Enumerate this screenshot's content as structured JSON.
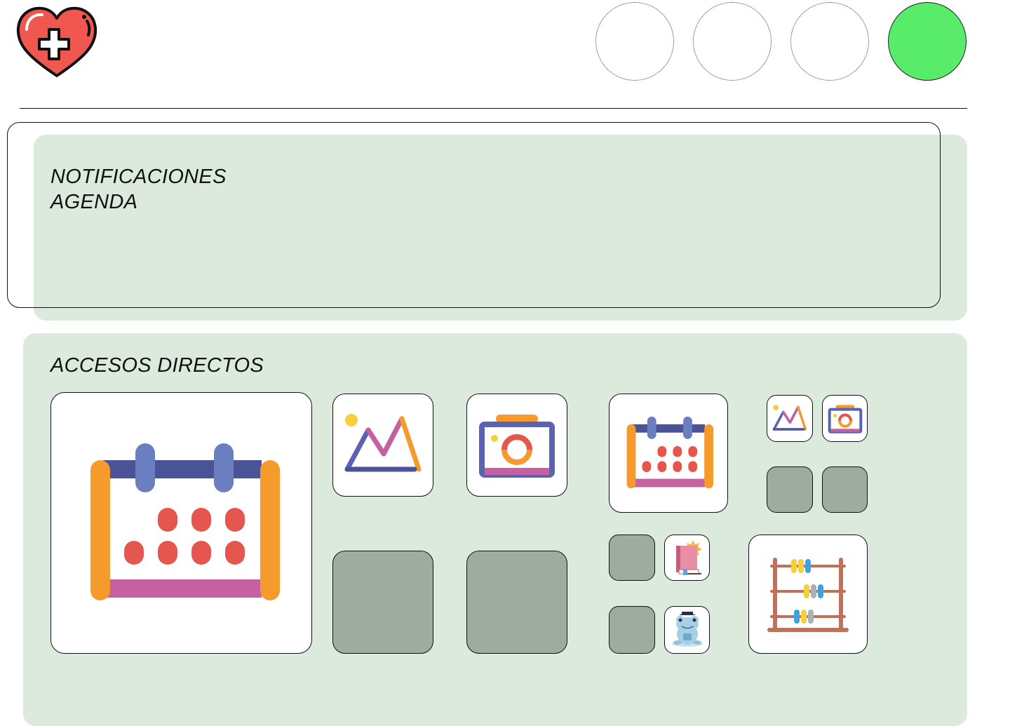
{
  "colors": {
    "panel_bg": "#dbeadd",
    "placeholder_tile": "#9eab9f",
    "active_circle": "#59ec6b",
    "icon_orange": "#f59a2c",
    "icon_navy": "#4a5398",
    "icon_blue": "#6a7ec0",
    "icon_red": "#e5564e",
    "icon_pink": "#c561a0",
    "icon_yellow": "#f5cf3c"
  },
  "header": {
    "logo_icon": "heart-plus-icon",
    "nav_circles": [
      {
        "state": "empty"
      },
      {
        "state": "empty"
      },
      {
        "state": "empty"
      },
      {
        "state": "active"
      }
    ]
  },
  "notifications": {
    "title_line1": "NOTIFICACIONES",
    "title_line2": "AGENDA"
  },
  "shortcuts": {
    "title": "ACCESOS DIRECTOS",
    "icons": [
      "calendar-icon",
      "gallery-icon",
      "camera-icon",
      "calendar-icon",
      "gallery-icon",
      "camera-icon",
      "book-icon",
      "frog-icon",
      "abacus-icon"
    ]
  }
}
